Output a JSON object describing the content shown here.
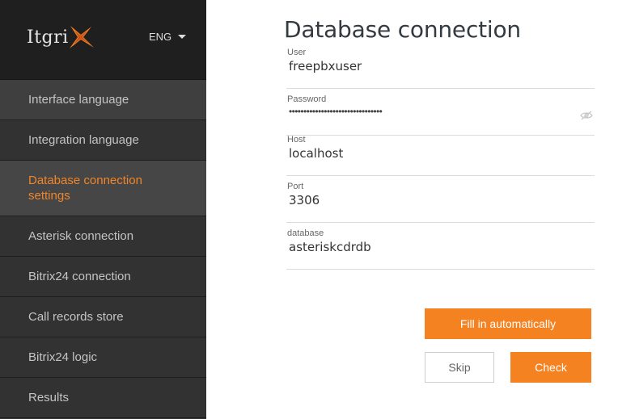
{
  "brand": {
    "logo_text": "Itgri",
    "logo_mark": "x-star-logo"
  },
  "header": {
    "language": "ENG"
  },
  "sidebar": {
    "items": [
      {
        "label": "Interface language"
      },
      {
        "label": "Integration language"
      },
      {
        "label": "Database connection settings",
        "active": true
      },
      {
        "label": "Asterisk connection"
      },
      {
        "label": "Bitrix24 connection"
      },
      {
        "label": "Call records store"
      },
      {
        "label": "Bitrix24 logic"
      },
      {
        "label": "Results"
      }
    ]
  },
  "main": {
    "title": "Database connection",
    "fields": {
      "user": {
        "label": "User",
        "value": "freepbxuser"
      },
      "password": {
        "label": "Password",
        "masked": "••••••••••••••••••••••••••••••••",
        "icon": "eye-off-icon"
      },
      "host": {
        "label": "Host",
        "value": "localhost"
      },
      "port": {
        "label": "Port",
        "value": "3306"
      },
      "database": {
        "label": "database",
        "value": "asteriskcdrdb"
      }
    },
    "buttons": {
      "fill": "Fill in automatically",
      "skip": "Skip",
      "check": "Check"
    }
  },
  "colors": {
    "accent": "#f58220",
    "sidebar_bg": "#323232",
    "header_bg": "#1f1f1f",
    "active_item_bg": "#464646",
    "active_text": "#f0852b"
  }
}
